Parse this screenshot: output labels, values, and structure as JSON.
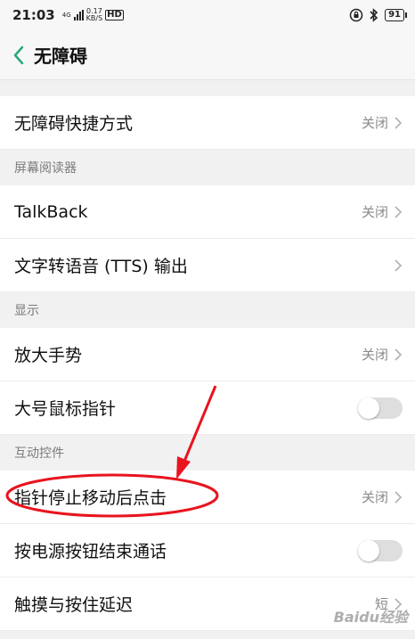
{
  "status_bar": {
    "time": "21:03",
    "network_type": "4G",
    "speed_value": "0.17",
    "speed_unit": "KB/S",
    "hd": "HD",
    "battery": "91"
  },
  "header": {
    "title": "无障碍"
  },
  "rows": {
    "shortcut": {
      "label": "无障碍快捷方式",
      "value": "关闭"
    },
    "talkback": {
      "label": "TalkBack",
      "value": "关闭"
    },
    "tts": {
      "label": "文字转语音 (TTS) 输出"
    },
    "magnify": {
      "label": "放大手势",
      "value": "关闭"
    },
    "large_pointer": {
      "label": "大号鼠标指针",
      "toggle": false
    },
    "dwell_click": {
      "label": "指针停止移动后点击",
      "value": "关闭"
    },
    "power_end_call": {
      "label": "按电源按钮结束通话",
      "toggle": false
    },
    "touch_hold_delay": {
      "label": "触摸与按住延迟",
      "value": "短"
    }
  },
  "sections": {
    "screen_reader": "屏幕阅读器",
    "display": "显示",
    "interaction": "互动控件"
  },
  "colors": {
    "accent": "#2aa876",
    "annotation": "#e8141e"
  },
  "watermark": "Baidu经验"
}
